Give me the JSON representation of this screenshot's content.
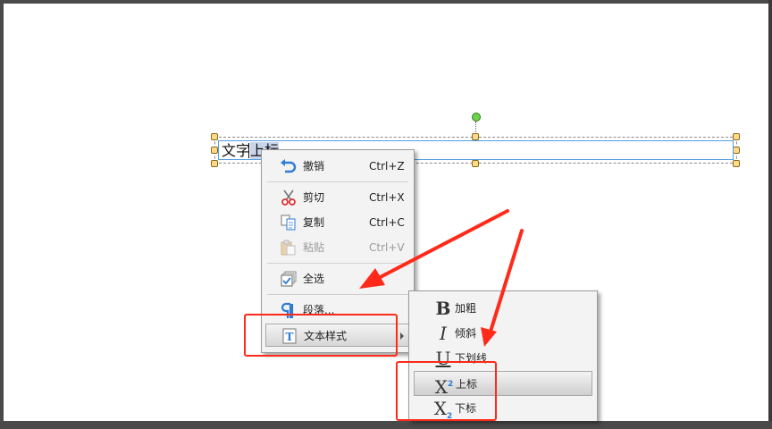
{
  "textbox": {
    "text_unselected": "文字",
    "text_selected": "上标"
  },
  "context_menu": {
    "items": [
      {
        "label": "撤销",
        "shortcut": "Ctrl+Z",
        "icon": "undo-icon",
        "enabled": true
      },
      {
        "label": "剪切",
        "shortcut": "Ctrl+X",
        "icon": "scissors-icon",
        "enabled": true
      },
      {
        "label": "复制",
        "shortcut": "Ctrl+C",
        "icon": "copy-icon",
        "enabled": true
      },
      {
        "label": "粘贴",
        "shortcut": "Ctrl+V",
        "icon": "paste-icon",
        "enabled": false
      },
      {
        "label": "全选",
        "shortcut": "",
        "icon": "select-all-icon",
        "enabled": true
      },
      {
        "label": "段落...",
        "shortcut": "",
        "icon": "paragraph-icon",
        "enabled": true
      },
      {
        "label": "文本样式",
        "shortcut": "",
        "icon": "text-style-icon",
        "enabled": true,
        "active": true
      }
    ]
  },
  "text_style_submenu": {
    "items": [
      {
        "glyph": "B",
        "label": "加粗",
        "icon": "bold-icon"
      },
      {
        "glyph": "I",
        "label": "倾斜",
        "icon": "italic-icon"
      },
      {
        "glyph": "U",
        "label": "下划线",
        "icon": "underline-icon"
      },
      {
        "glyph": "X",
        "glyph_mark": "2",
        "label": "上标",
        "icon": "superscript-icon",
        "active": true
      },
      {
        "glyph": "X",
        "glyph_mark": "2",
        "label": "下标",
        "icon": "subscript-icon"
      }
    ]
  },
  "colors": {
    "annotation_red": "#ff2a1a",
    "selection_blue": "#57a0e0",
    "icon_blue": "#2e7bd6"
  }
}
